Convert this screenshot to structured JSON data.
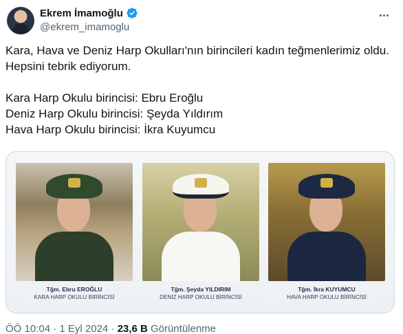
{
  "author": {
    "display_name": "Ekrem İmamoğlu",
    "handle": "@ekrem_imamoglu",
    "verified_color": "#1d9bf0"
  },
  "tweet": {
    "paragraph1": "Kara, Hava ve Deniz Harp Okulları'nın birincileri kadın teğmenlerimiz oldu. Hepsini tebrik ediyorum.",
    "line1": "Kara Harp Okulu birincisi: Ebru Eroğlu",
    "line2": "Deniz Harp Okulu birincisi: Şeyda Yıldırım",
    "line3": "Hava Harp Okulu birincisi: İkra Kuyumcu"
  },
  "media": {
    "cards": [
      {
        "name": "Tğm. Ebru EROĞLU",
        "school": "KARA HARP OKULU BİRİNCİSİ"
      },
      {
        "name": "Tğm. Şeyda YILDIRIM",
        "school": "DENİZ HARP OKULU BİRİNCİSİ"
      },
      {
        "name": "Tğm. İkra KUYUMCU",
        "school": "HAVA HARP OKULU BİRİNCİSİ"
      }
    ]
  },
  "meta": {
    "time_date": "ÖÖ 10:04 · 1 Eyl 2024 · ",
    "views_count": "23,6 B",
    "views_label": " Görüntülenme"
  }
}
